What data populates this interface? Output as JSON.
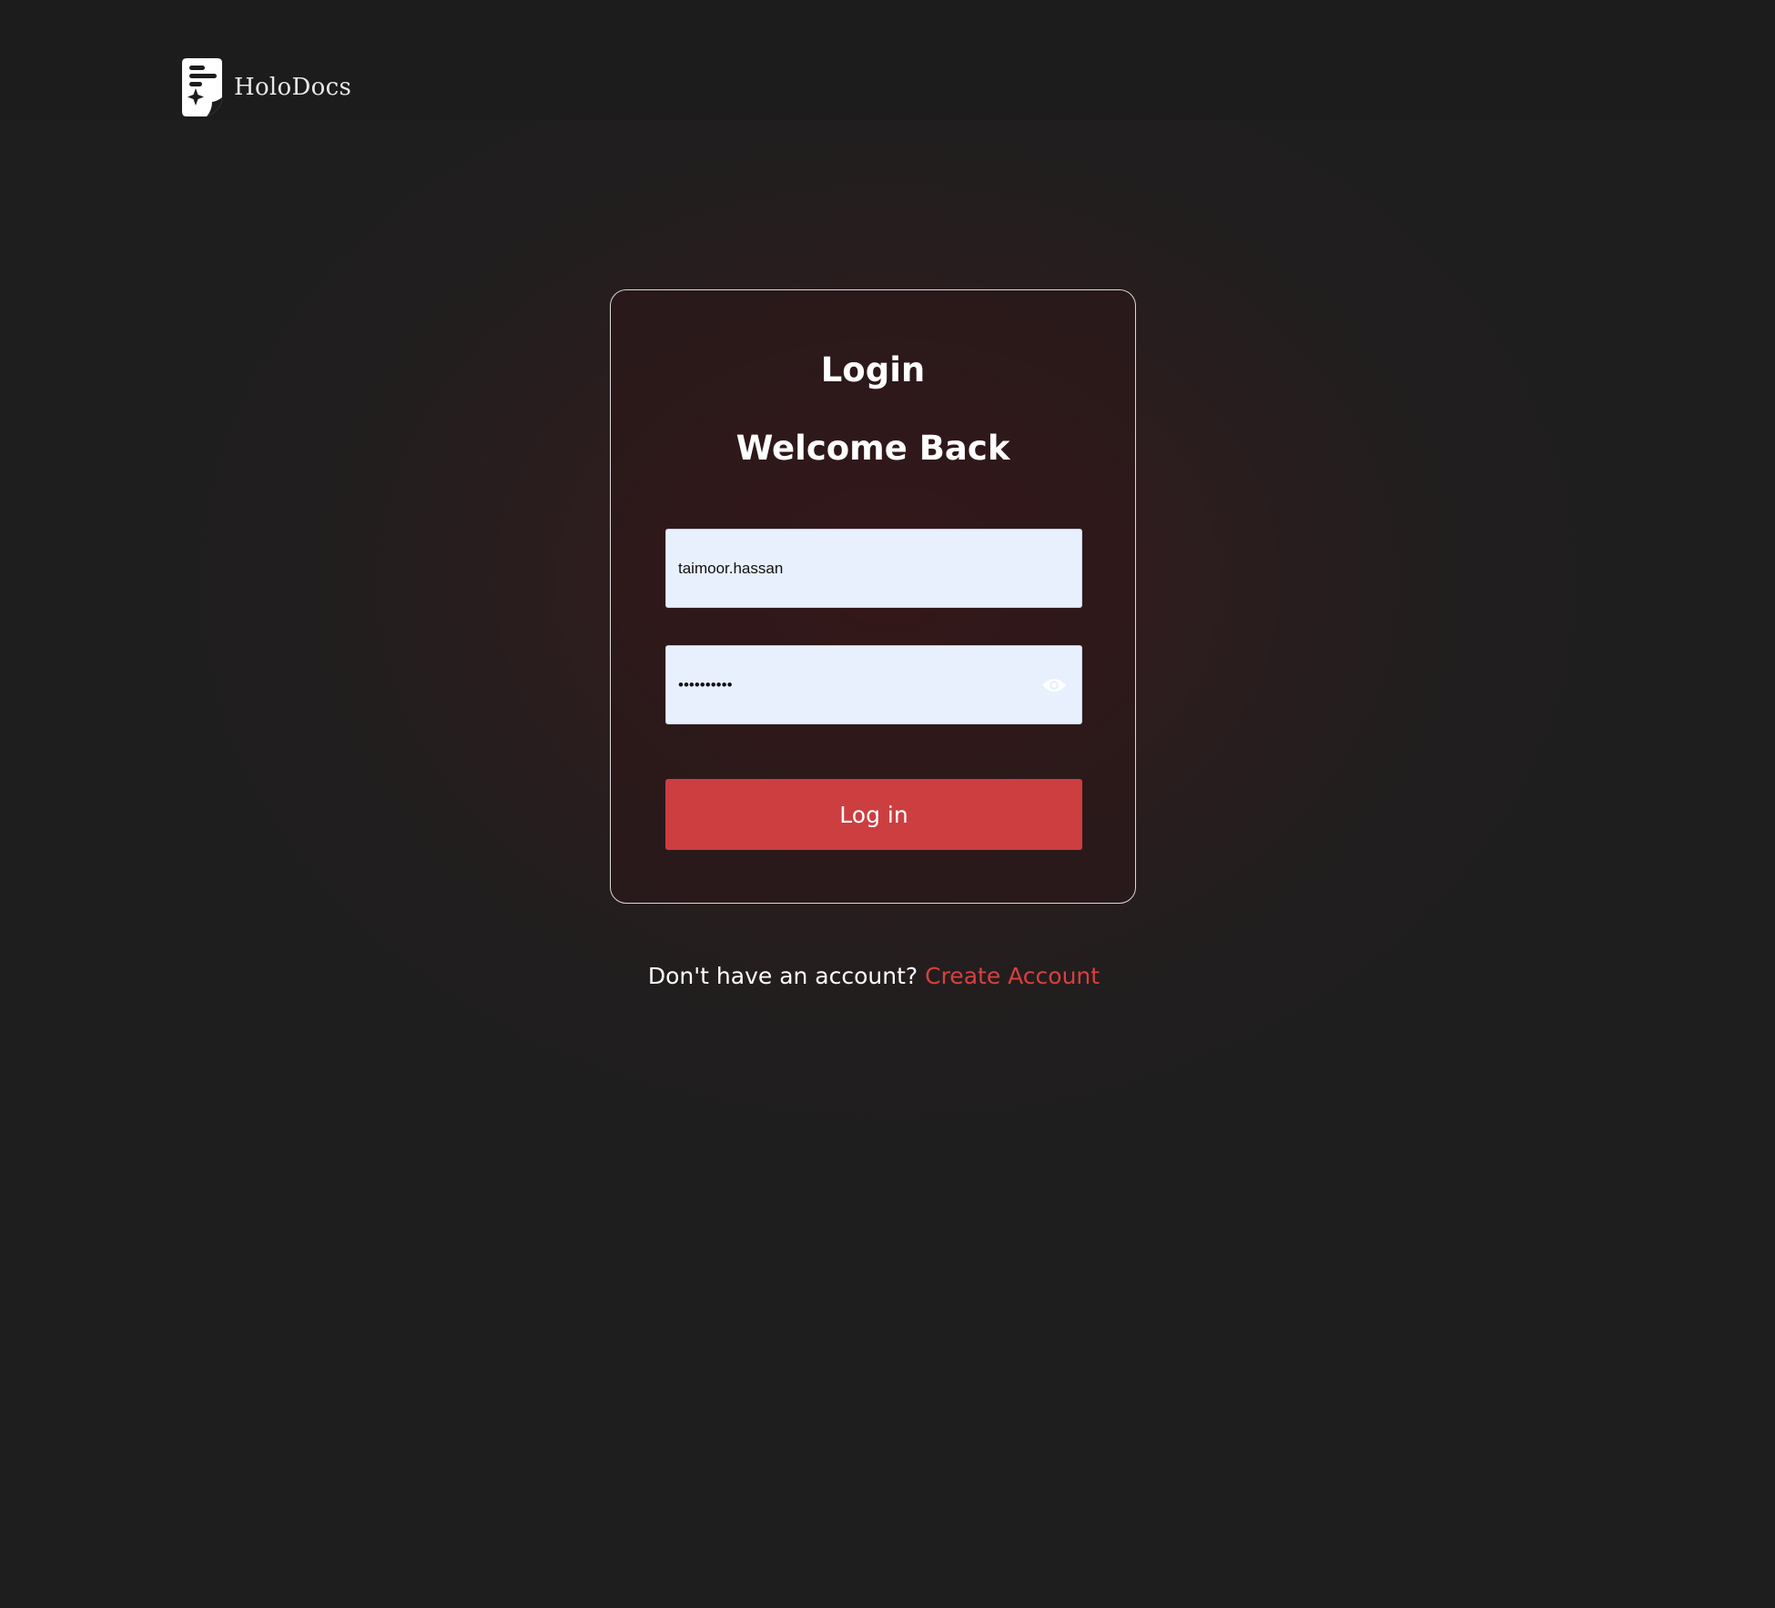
{
  "header": {
    "brand_name": "HoloDocs",
    "logo_icon": "document-sparkle-icon"
  },
  "login_card": {
    "title": "Login",
    "subtitle": "Welcome Back",
    "username": {
      "value": "taimoor.hassan"
    },
    "password": {
      "value": "••••••••••",
      "toggle_icon": "eye-icon"
    },
    "submit_label": "Log in"
  },
  "signup": {
    "prompt": "Don't have an account?",
    "link_label": "Create Account"
  },
  "colors": {
    "background": "#1e1e1e",
    "accent": "#cc3e40",
    "link": "#d8403f",
    "input_bg": "#e8f0fe"
  }
}
